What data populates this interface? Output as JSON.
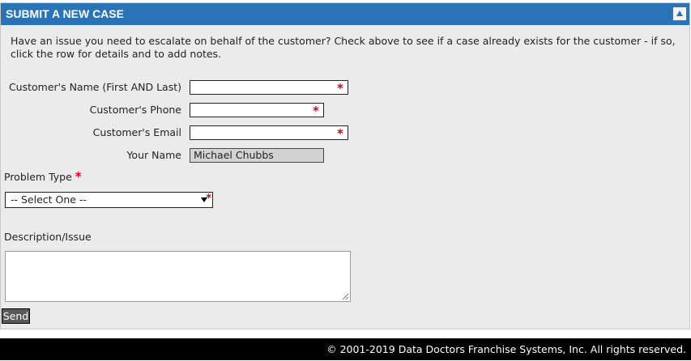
{
  "panel": {
    "title": "SUBMIT A NEW CASE",
    "intro": "Have an issue you need to escalate on behalf of the customer? Check above to see if a case already exists for the customer - if so, click the row for details and to add notes."
  },
  "form": {
    "name_label": "Customer's Name (First AND Last)",
    "name_value": "",
    "phone_label": "Customer's Phone",
    "phone_value": "",
    "email_label": "Customer's Email",
    "email_value": "",
    "your_name_label": "Your Name",
    "your_name_value": "Michael Chubbs",
    "required_mark": "*",
    "problem_type_label": "Problem Type",
    "problem_type_selected": "-- Select One --",
    "description_label": "Description/Issue",
    "description_value": "",
    "send_label": "Send"
  },
  "footer": {
    "copyright": "© 2001-2019 Data Doctors Franchise Systems, Inc. All rights reserved."
  },
  "colors": {
    "header_bg": "#2a73b7",
    "panel_bg": "#ebebeb",
    "required": "#e0001b",
    "footer_bg": "#000000"
  },
  "icons": {
    "collapse": "triangle-up-icon",
    "required": "asterisk-icon",
    "dropdown": "caret-down-icon",
    "resize": "resize-grip-icon"
  }
}
